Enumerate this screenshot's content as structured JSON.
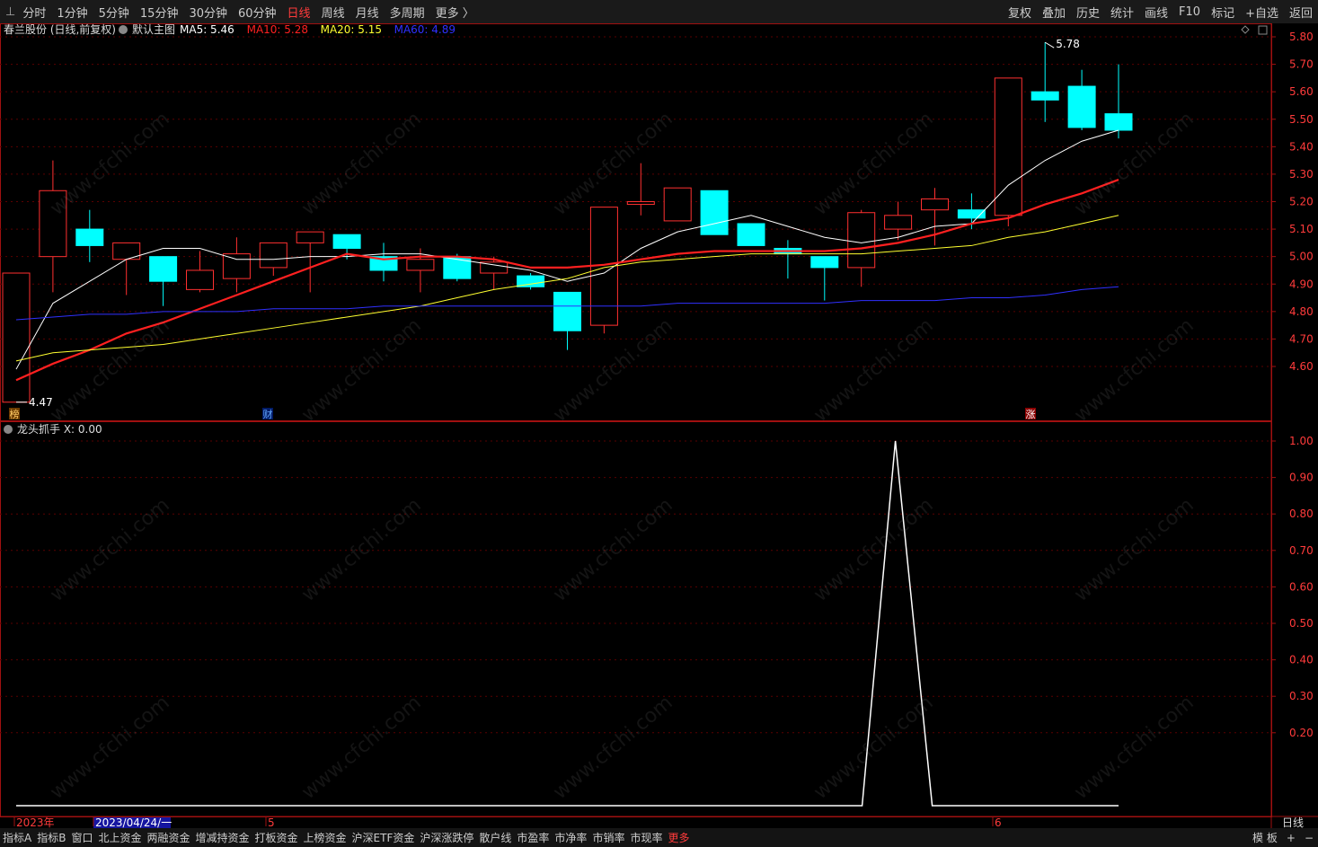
{
  "toolbar": {
    "arrow": "⊥",
    "periods": [
      "分时",
      "1分钟",
      "5分钟",
      "15分钟",
      "30分钟",
      "60分钟",
      "日线",
      "周线",
      "月线",
      "多周期",
      "更多 〉"
    ],
    "active_period": "日线",
    "tools": [
      "复权",
      "叠加",
      "历史",
      "统计",
      "画线",
      "F10",
      "标记",
      "+自选",
      "返回"
    ]
  },
  "main_panel": {
    "stock_label": "春兰股份 (日线,前复权)",
    "template_label": "默认主图",
    "ma_labels": [
      {
        "text": "MA5: 5.46",
        "color": "#ffffff"
      },
      {
        "text": "MA10: 5.28",
        "color": "#ff2020"
      },
      {
        "text": "MA20: 5.15",
        "color": "#ffff30"
      },
      {
        "text": "MA60: 4.89",
        "color": "#3030ff"
      }
    ],
    "y_ticks": [
      "5.80",
      "5.70",
      "5.60",
      "5.50",
      "5.40",
      "5.30",
      "5.20",
      "5.10",
      "5.00",
      "4.90",
      "4.80",
      "4.70",
      "4.60"
    ],
    "high_label": "5.78",
    "low_label": "4.47",
    "event_markers": [
      "榜",
      "财",
      "涨"
    ]
  },
  "indicator_panel": {
    "label": "龙头抓手  X: 0.00",
    "y_ticks": [
      "1.00",
      "0.90",
      "0.80",
      "0.70",
      "0.60",
      "0.50",
      "0.40",
      "0.30",
      "0.20"
    ]
  },
  "date_axis": {
    "labels": [
      "2023年",
      "2023/04/24/一",
      "5",
      "6"
    ],
    "period_label": "日线"
  },
  "bottom_tabs": [
    "指标A",
    "指标B",
    "窗口",
    "北上资金",
    "两融资金",
    "增减持资金",
    "打板资金",
    "上榜资金",
    "沪深ETF资金",
    "沪深涨跌停",
    "散户线",
    "市盈率",
    "市净率",
    "市销率",
    "市现率",
    "更多"
  ],
  "bottom_right": [
    "模 板",
    "+",
    "−"
  ],
  "watermark": "www.cfchi.com",
  "colors": {
    "up": "#ff3030",
    "down": "#00ffff",
    "ma5": "#ffffff",
    "ma10": "#ff2020",
    "ma20": "#ffff30",
    "ma60": "#3030ff",
    "axis": "#a01010",
    "indicator": "#ffffff"
  },
  "chart_data": [
    {
      "type": "candlestick",
      "title": "春兰股份 (日线,前复权)",
      "ylim": [
        4.47,
        5.85
      ],
      "candles": [
        {
          "o": 4.47,
          "h": 4.94,
          "l": 4.47,
          "c": 4.94
        },
        {
          "o": 5.0,
          "h": 5.35,
          "l": 4.87,
          "c": 5.24
        },
        {
          "o": 5.1,
          "h": 5.17,
          "l": 4.98,
          "c": 5.04
        },
        {
          "o": 4.99,
          "h": 5.05,
          "l": 4.86,
          "c": 5.05
        },
        {
          "o": 5.0,
          "h": 5.0,
          "l": 4.82,
          "c": 4.91
        },
        {
          "o": 4.88,
          "h": 5.02,
          "l": 4.87,
          "c": 4.95
        },
        {
          "o": 4.92,
          "h": 5.07,
          "l": 4.87,
          "c": 5.01
        },
        {
          "o": 4.96,
          "h": 5.05,
          "l": 4.93,
          "c": 5.05
        },
        {
          "o": 5.05,
          "h": 5.09,
          "l": 4.87,
          "c": 5.09
        },
        {
          "o": 5.08,
          "h": 5.08,
          "l": 4.99,
          "c": 5.03
        },
        {
          "o": 5.0,
          "h": 5.05,
          "l": 4.91,
          "c": 4.95
        },
        {
          "o": 4.95,
          "h": 5.03,
          "l": 4.87,
          "c": 4.99
        },
        {
          "o": 5.0,
          "h": 5.01,
          "l": 4.91,
          "c": 4.92
        },
        {
          "o": 4.94,
          "h": 5.0,
          "l": 4.88,
          "c": 4.98
        },
        {
          "o": 4.93,
          "h": 4.94,
          "l": 4.88,
          "c": 4.89
        },
        {
          "o": 4.87,
          "h": 4.87,
          "l": 4.66,
          "c": 4.73
        },
        {
          "o": 4.75,
          "h": 5.18,
          "l": 4.72,
          "c": 5.18
        },
        {
          "o": 5.19,
          "h": 5.34,
          "l": 5.15,
          "c": 5.2
        },
        {
          "o": 5.13,
          "h": 5.25,
          "l": 5.13,
          "c": 5.25
        },
        {
          "o": 5.24,
          "h": 5.24,
          "l": 5.08,
          "c": 5.08
        },
        {
          "o": 5.12,
          "h": 5.12,
          "l": 5.04,
          "c": 5.04
        },
        {
          "o": 5.03,
          "h": 5.06,
          "l": 4.92,
          "c": 5.01
        },
        {
          "o": 5.0,
          "h": 5.0,
          "l": 4.84,
          "c": 4.96
        },
        {
          "o": 4.96,
          "h": 5.17,
          "l": 4.89,
          "c": 5.16
        },
        {
          "o": 5.1,
          "h": 5.2,
          "l": 5.06,
          "c": 5.15
        },
        {
          "o": 5.17,
          "h": 5.25,
          "l": 5.04,
          "c": 5.21
        },
        {
          "o": 5.17,
          "h": 5.23,
          "l": 5.1,
          "c": 5.14
        },
        {
          "o": 5.15,
          "h": 5.65,
          "l": 5.11,
          "c": 5.65
        },
        {
          "o": 5.6,
          "h": 5.78,
          "l": 5.49,
          "c": 5.57
        },
        {
          "o": 5.62,
          "h": 5.68,
          "l": 5.46,
          "c": 5.47
        },
        {
          "o": 5.52,
          "h": 5.7,
          "l": 5.43,
          "c": 5.46
        }
      ],
      "series": [
        {
          "name": "MA5",
          "values": [
            4.59,
            4.83,
            4.91,
            4.99,
            5.03,
            5.03,
            4.99,
            4.99,
            5.0,
            5.0,
            5.01,
            5.01,
            4.99,
            4.97,
            4.95,
            4.91,
            4.94,
            5.03,
            5.09,
            5.12,
            5.15,
            5.11,
            5.07,
            5.05,
            5.07,
            5.11,
            5.12,
            5.26,
            5.35,
            5.42,
            5.46
          ]
        },
        {
          "name": "MA10",
          "values": [
            4.55,
            4.61,
            4.66,
            4.72,
            4.76,
            4.81,
            4.86,
            4.91,
            4.96,
            5.01,
            4.99,
            5.0,
            5.0,
            4.99,
            4.96,
            4.96,
            4.97,
            4.99,
            5.01,
            5.02,
            5.02,
            5.02,
            5.02,
            5.03,
            5.05,
            5.08,
            5.12,
            5.14,
            5.19,
            5.23,
            5.28
          ]
        },
        {
          "name": "MA20",
          "values": [
            4.62,
            4.65,
            4.66,
            4.67,
            4.68,
            4.7,
            4.72,
            4.74,
            4.76,
            4.78,
            4.8,
            4.82,
            4.85,
            4.88,
            4.9,
            4.92,
            4.96,
            4.98,
            4.99,
            5.0,
            5.01,
            5.01,
            5.01,
            5.01,
            5.02,
            5.03,
            5.04,
            5.07,
            5.09,
            5.12,
            5.15
          ]
        },
        {
          "name": "MA60",
          "values": [
            4.77,
            4.78,
            4.79,
            4.79,
            4.8,
            4.8,
            4.8,
            4.81,
            4.81,
            4.81,
            4.82,
            4.82,
            4.82,
            4.82,
            4.82,
            4.82,
            4.82,
            4.82,
            4.83,
            4.83,
            4.83,
            4.83,
            4.83,
            4.84,
            4.84,
            4.84,
            4.85,
            4.85,
            4.86,
            4.88,
            4.89
          ]
        }
      ]
    },
    {
      "type": "line",
      "title": "龙头抓手",
      "ylim": [
        0,
        1
      ],
      "series": [
        {
          "name": "X",
          "values": [
            0,
            0,
            0,
            0,
            0,
            0,
            0,
            0,
            0,
            0,
            0,
            0,
            0,
            0,
            0,
            0,
            0,
            0,
            0,
            0,
            0,
            0,
            0,
            0,
            1,
            0,
            0,
            0,
            0,
            0,
            0
          ]
        }
      ]
    }
  ]
}
